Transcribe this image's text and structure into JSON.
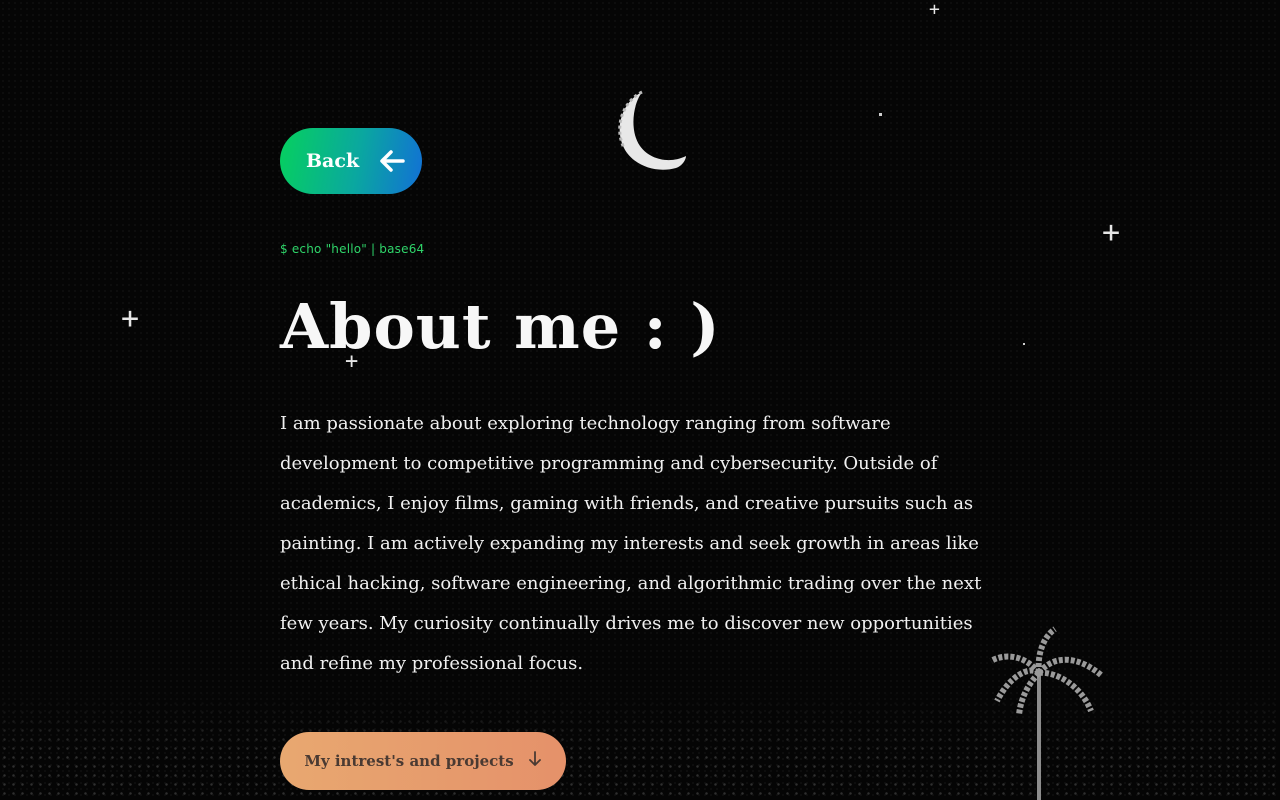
{
  "nav": {
    "back_label": "Back",
    "back_icon": "arrow-left-icon"
  },
  "terminal_line": "$ echo \"hello\" | base64",
  "heading": "About me : )",
  "bio": "I am passionate about exploring technology ranging from software development to competitive programming and cybersecurity. Outside of academics, I enjoy films, gaming with friends, and creative pursuits such as painting. I am actively expanding my interests and seek growth in areas like ethical hacking, software engineering, and algorithmic trading over the next few years. My curiosity continually drives me to discover new opportunities and refine my professional focus.",
  "cta": {
    "label": "My intrest's and projects",
    "icon": "arrow-down-icon"
  },
  "colors": {
    "background": "#050505",
    "back_gradient": [
      "#06d05e",
      "#1270d6"
    ],
    "terminal_green": "#2fd56a",
    "cta_gradient": [
      "#e8a870",
      "#e5916a"
    ]
  },
  "decor": {
    "moon_icon": "crescent-moon-icon",
    "star_icon": "sparkle-star-icon",
    "palm_icon": "palm-tree-icon"
  }
}
